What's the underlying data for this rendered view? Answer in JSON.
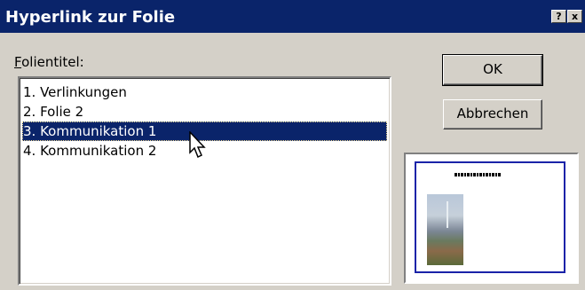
{
  "dialog": {
    "title": "Hyperlink zur Folie",
    "help_button": "?",
    "close_button": "x"
  },
  "list": {
    "label_accel": "F",
    "label_rest": "olientitel:",
    "items": [
      "1. Verlinkungen",
      "2. Folie 2",
      "3. Kommunikation 1",
      "4. Kommunikation 2"
    ],
    "selected_index": 2
  },
  "buttons": {
    "ok": "OK",
    "cancel": "Abbrechen"
  },
  "colors": {
    "titlebar": "#0a246a",
    "selection": "#0a246a",
    "dialog_bg": "#d4d0c8",
    "slide_border": "#1a23a8"
  }
}
